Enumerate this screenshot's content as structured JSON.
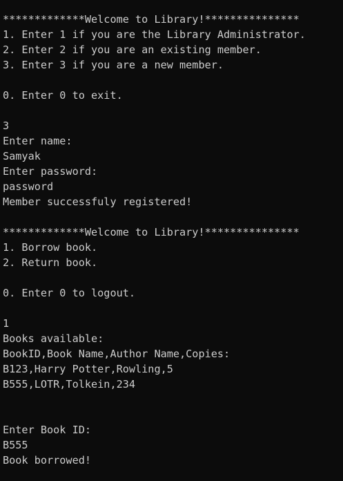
{
  "terminal": {
    "lines": [
      "*************Welcome to Library!***************",
      "1. Enter 1 if you are the Library Administrator.",
      "2. Enter 2 if you are an existing member.",
      "3. Enter 3 if you are a new member.",
      "",
      "0. Enter 0 to exit.",
      "",
      "3",
      "Enter name:",
      "Samyak",
      "Enter password:",
      "password",
      "Member successfuly registered!",
      "",
      "*************Welcome to Library!***************",
      "1. Borrow book.",
      "2. Return book.",
      "",
      "0. Enter 0 to logout.",
      "",
      "1",
      "Books available:",
      "BookID,Book Name,Author Name,Copies:",
      "B123,Harry Potter,Rowling,5",
      "B555,LOTR,Tolkein,234",
      "",
      "",
      "Enter Book ID:",
      "B555",
      "Book borrowed!"
    ]
  }
}
